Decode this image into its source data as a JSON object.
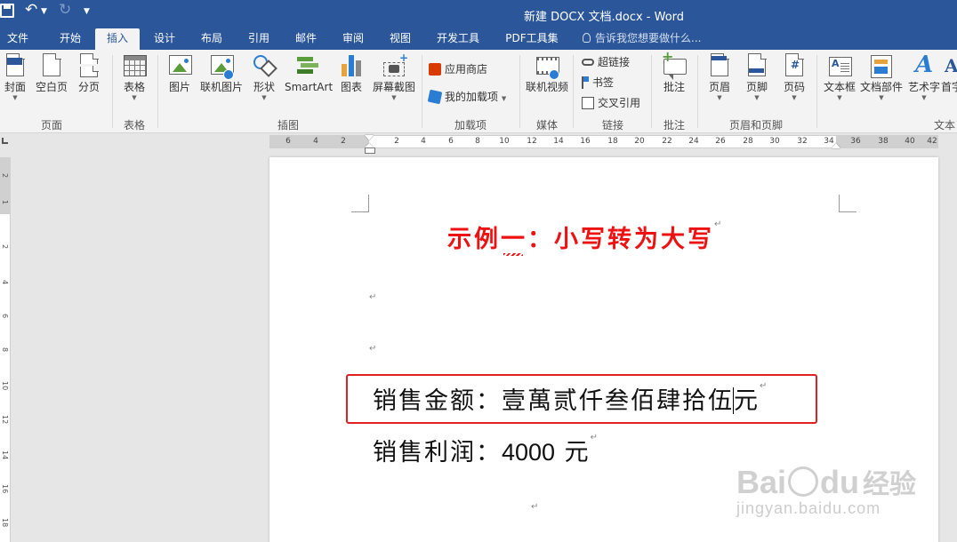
{
  "window": {
    "title": "新建 DOCX 文档.docx - Word",
    "accent": "#2b579a"
  },
  "tabs": [
    {
      "label": "文件"
    },
    {
      "label": "开始"
    },
    {
      "label": "插入",
      "active": true
    },
    {
      "label": "设计"
    },
    {
      "label": "布局"
    },
    {
      "label": "引用"
    },
    {
      "label": "邮件"
    },
    {
      "label": "审阅"
    },
    {
      "label": "视图"
    },
    {
      "label": "开发工具"
    },
    {
      "label": "PDF工具集"
    }
  ],
  "tell_me": "告诉我您想要做什么...",
  "ribbon": {
    "pages": {
      "cover": "封面",
      "blank": "空白页",
      "break": "分页",
      "group": "页面"
    },
    "table": {
      "table": "表格",
      "group": "表格"
    },
    "illustrations": {
      "picture": "图片",
      "online_picture": "联机图片",
      "shapes": "形状",
      "smartart": "SmartArt",
      "chart": "图表",
      "screenshot": "屏幕截图",
      "group": "插图"
    },
    "addins": {
      "store": "应用商店",
      "my_addins": "我的加载项",
      "group": "加载项"
    },
    "media": {
      "online_video": "联机视频",
      "group": "媒体"
    },
    "links": {
      "hyperlink": "超链接",
      "bookmark": "书签",
      "cross_ref": "交叉引用",
      "group": "链接"
    },
    "comments": {
      "comment": "批注",
      "group": "批注"
    },
    "header_footer": {
      "header": "页眉",
      "footer": "页脚",
      "page_number": "页码",
      "group": "页眉和页脚"
    },
    "text": {
      "textbox": "文本框",
      "quick_parts": "文档部件",
      "wordart": "艺术字",
      "dropcap": "首字",
      "group": "文本"
    }
  },
  "ruler": {
    "h_ticks": [
      "6",
      "4",
      "2",
      "2",
      "4",
      "6",
      "8",
      "10",
      "12",
      "14",
      "16",
      "18",
      "20",
      "22",
      "24",
      "26",
      "28",
      "30",
      "32",
      "34",
      "36",
      "38",
      "40",
      "42"
    ],
    "v_ticks": [
      "2",
      "1",
      "2",
      "4",
      "6",
      "8",
      "10",
      "12",
      "14",
      "16",
      "18"
    ]
  },
  "document": {
    "heading": "示例一：小写转为大写",
    "heading_color": "#ee1111",
    "line1_label": "销售金额：",
    "line1_value": "壹萬贰仟叁佰肆拾伍",
    "line1_unit": "元",
    "line2_label": "销售利润：",
    "line2_value": "4000",
    "line2_unit": "元",
    "para_mark": "↵",
    "highlight_color": "#e02020"
  },
  "watermark": {
    "brand_a": "Bai",
    "brand_b": "du",
    "brand_cn": "经验",
    "url": "jingyan.baidu.com"
  }
}
